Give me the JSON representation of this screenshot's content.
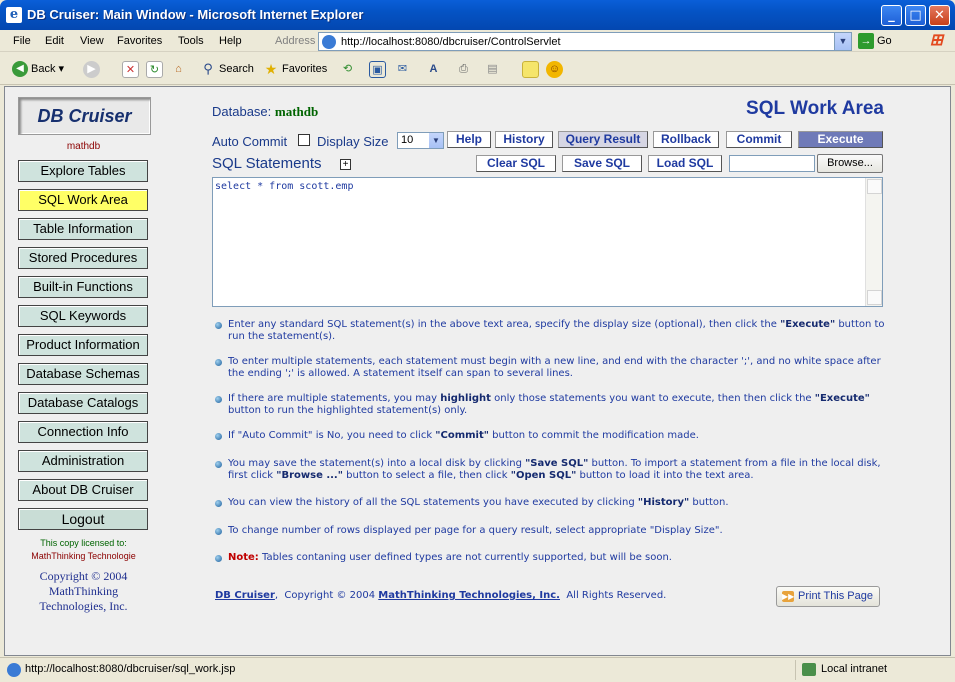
{
  "window": {
    "title": "DB Cruiser: Main Window - Microsoft Internet Explorer",
    "minimize": "_",
    "maximize": "□",
    "close": "✕"
  },
  "menu": [
    "File",
    "Edit",
    "View",
    "Favorites",
    "Tools",
    "Help"
  ],
  "address": {
    "label": "Address",
    "url": "http://localhost:8080/dbcruiser/ControlServlet",
    "go": "Go"
  },
  "toolbar": {
    "back": "Back",
    "search": "Search",
    "favorites": "Favorites"
  },
  "sidebar": {
    "logo": "DB Cruiser",
    "db_name": "mathdb",
    "items": [
      "Explore Tables",
      "SQL Work Area",
      "Table Information",
      "Stored Procedures",
      "Built-in Functions",
      "SQL Keywords",
      "Product Information",
      "Database Schemas",
      "Database Catalogs",
      "Connection Info",
      "Administration",
      "About DB Cruiser"
    ],
    "active_index": 1,
    "logout": "Logout",
    "license_line1": "This copy licensed to:",
    "license_line2": "MathThinking Technologie",
    "copyright_lines": [
      "Copyright © 2004",
      "MathThinking",
      "Technologies, Inc."
    ]
  },
  "main": {
    "db_label": "Database:",
    "db_value": "mathdb",
    "title": "SQL Work Area",
    "auto_commit_label": "Auto Commit",
    "display_size_label": "Display Size",
    "display_size_value": "10",
    "buttons": {
      "help": "Help",
      "history": "History",
      "query_result": "Query Result",
      "rollback": "Rollback",
      "commit": "Commit",
      "execute": "Execute",
      "clear_sql": "Clear SQL",
      "save_sql": "Save SQL",
      "load_sql": "Load SQL",
      "browse": "Browse..."
    },
    "sql_label": "SQL Statements",
    "sql_text": "select * from scott.emp",
    "tips": [
      {
        "a": "Enter any standard SQL statement(s) in the above text area, specify the display size (optional), then click the ",
        "b": "\"Execute\"",
        "c": " button to run the statement(s)."
      },
      {
        "a": "To enter multiple statements, each statement must begin with a new line, and end with the character ';', and no white space after the ending ';' is allowed. A statement itself can span to several lines.",
        "b": "",
        "c": ""
      },
      {
        "a": "If there are multiple statements, you may ",
        "b": "highlight",
        "c": " only those statements you want to execute, then then click the ",
        "d": "\"Execute\"",
        "e": " button to run the highlighted statement(s) only."
      },
      {
        "a": "If \"Auto Commit\" is No, you need to click ",
        "b": "\"Commit\"",
        "c": " button to commit the modification made."
      },
      {
        "a": "You may save the statement(s) into a local disk by clicking ",
        "b": "\"Save SQL\"",
        "c": " button. To import a statement from a file in the local disk, first click ",
        "d": "\"Browse ...\"",
        "e": " button to select a file, then click ",
        "f": "\"Open SQL\"",
        "g": " button to load it into the text area."
      },
      {
        "a": "You can view the history of all the SQL statements you have executed by clicking ",
        "b": "\"History\"",
        "c": " button."
      },
      {
        "a": "To change number of rows displayed per page for a query result, select appropriate \"Display Size\".",
        "b": "",
        "c": ""
      },
      {
        "note": "Note:",
        "a": " Tables contaning user defined types are not currently supported, but will be soon."
      }
    ],
    "footer": {
      "product": "DB Cruiser",
      "mid": ",  Copyright © 2004 ",
      "company": "MathThinking Technologies, Inc.",
      "end": "  All Rights Reserved."
    },
    "print": "Print This Page"
  },
  "status": {
    "url": "http://localhost:8080/dbcruiser/sql_work.jsp",
    "zone": "Local intranet"
  }
}
